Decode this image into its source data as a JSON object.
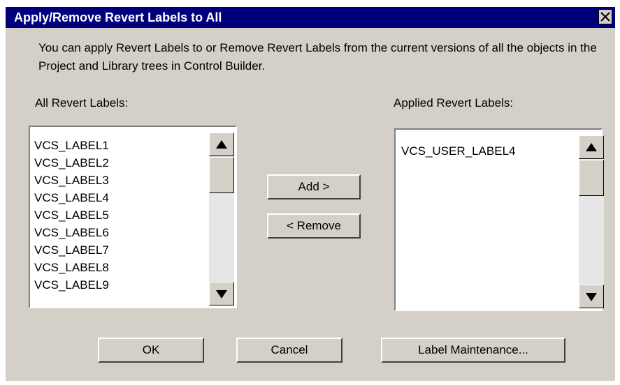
{
  "dialog": {
    "title": "Apply/Remove Revert Labels to All",
    "description": "You can apply Revert Labels to or Remove Revert Labels from the current versions of all the objects in the Project and Library trees in Control Builder."
  },
  "all_labels": {
    "heading": "All Revert  Labels:",
    "items": [
      "VCS_LABEL1",
      "VCS_LABEL2",
      "VCS_LABEL3",
      "VCS_LABEL4",
      "VCS_LABEL5",
      "VCS_LABEL6",
      "VCS_LABEL7",
      "VCS_LABEL8",
      "VCS_LABEL9"
    ]
  },
  "applied_labels": {
    "heading": "Applied Revert Labels:",
    "items": [
      "VCS_USER_LABEL4"
    ]
  },
  "buttons": {
    "add": "Add >",
    "remove": "< Remove",
    "ok": "OK",
    "cancel": "Cancel",
    "label_maintenance": "Label Maintenance..."
  },
  "icons": {
    "close": "close-icon",
    "scroll_up": "arrow-up-icon",
    "scroll_down": "arrow-down-icon"
  },
  "colors": {
    "title_bar": "#00007d",
    "dialog_bg": "#d4d0c8",
    "scroll_track": "#e6e6e6"
  }
}
